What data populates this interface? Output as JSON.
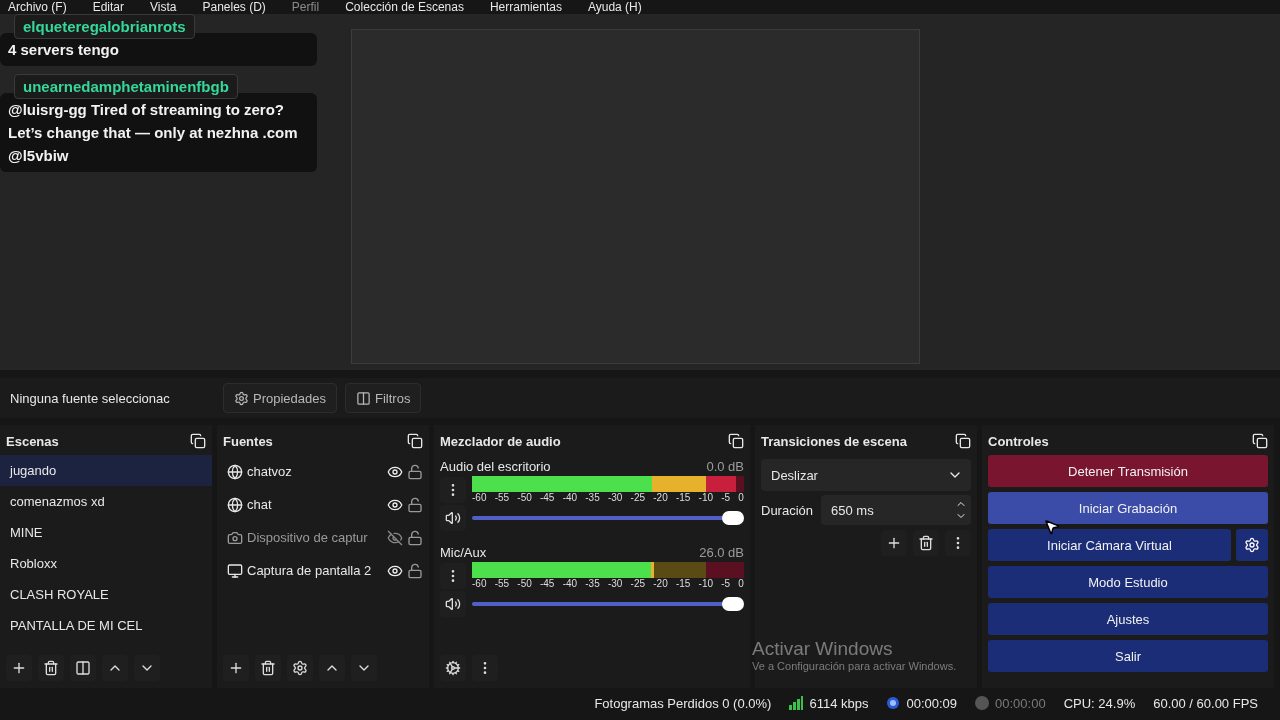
{
  "menu": [
    "Archivo (F)",
    "Editar",
    "Vista",
    "Paneles (D)",
    "Perfil",
    "Colección de Escenas",
    "Herramientas",
    "Ayuda (H)"
  ],
  "preview": {
    "chat_messages": [
      {
        "user": "elqueteregalobrianrots",
        "lines": [
          "4 servers tengo"
        ]
      },
      {
        "user": "unearnedamphetaminenfbgb",
        "lines": [
          "@luisrg-gg Tired of streaming to zero?",
          "Let’s change that — only at nezhna .com",
          "@l5vbiw"
        ]
      }
    ]
  },
  "source_toolbar": {
    "status": "Ninguna fuente seleccionac",
    "buttons": [
      {
        "kind": "properties",
        "label": "Propiedades"
      },
      {
        "kind": "filters",
        "label": "Filtros"
      }
    ]
  },
  "scenes": {
    "title": "Escenas",
    "items": [
      {
        "label": "jugando",
        "selected": true
      },
      {
        "label": "comenazmos xd",
        "selected": false
      },
      {
        "label": "MINE",
        "selected": false
      },
      {
        "label": "Robloxx",
        "selected": false
      },
      {
        "label": "CLASH ROYALE",
        "selected": false
      },
      {
        "label": "PANTALLA DE MI CEL",
        "selected": false
      }
    ]
  },
  "sources": {
    "title": "Fuentes",
    "items": [
      {
        "kind": "browser",
        "label": "chatvoz",
        "visible": true,
        "locked": false
      },
      {
        "kind": "browser",
        "label": "chat",
        "visible": true,
        "locked": false
      },
      {
        "kind": "camera",
        "label": "Dispositivo de captur",
        "visible": false,
        "locked": false
      },
      {
        "kind": "display",
        "label": "Captura de pantalla 2",
        "visible": true,
        "locked": false
      }
    ]
  },
  "mixer": {
    "title": "Mezclador de audio",
    "channels": [
      {
        "name": "Audio del escritorio",
        "reading": "0.0 dB",
        "meter": {
          "level": 0.97
        },
        "volume": {
          "level": 1
        },
        "scale": [
          "-60",
          "-55",
          "-50",
          "-45",
          "-40",
          "-35",
          "-30",
          "-25",
          "-20",
          "-15",
          "-10",
          "-5",
          "0"
        ]
      },
      {
        "name": "Mic/Aux",
        "reading": "26.0 dB",
        "meter": {
          "level": 0.67
        },
        "volume": {
          "level": 1
        },
        "scale": [
          "-60",
          "-55",
          "-50",
          "-45",
          "-40",
          "-35",
          "-30",
          "-25",
          "-20",
          "-15",
          "-10",
          "-5",
          "0"
        ]
      }
    ]
  },
  "transitions": {
    "title": "Transiciones de escena",
    "type": "Deslizar",
    "duration_label": "Duración",
    "duration": "650 ms"
  },
  "controls": {
    "title": "Controles",
    "buttons": [
      {
        "label": "Detener Transmisión",
        "kind": "danger",
        "hovered": false
      },
      {
        "label": "Iniciar Grabación",
        "kind": "normal",
        "hovered": true
      },
      {
        "label": "Iniciar Cámara Virtual",
        "kind": "with_settings",
        "hovered": false
      },
      {
        "label": "Modo Estudio",
        "kind": "normal",
        "hovered": false
      },
      {
        "label": "Ajustes",
        "kind": "normal",
        "hovered": false
      },
      {
        "label": "Salir",
        "kind": "normal",
        "hovered": false
      }
    ]
  },
  "os_notice": {
    "title": "Activar Windows",
    "subtitle": "Ve a Configuración para activar Windows."
  },
  "status_bar": {
    "dropped": "Fotogramas Perdidos 0 (0.0%)",
    "bitrate": "6114 kbps",
    "stream_time": "00:00:09",
    "record_time": "00:00:00",
    "cpu": "CPU: 24.9%",
    "fps": "60.00 / 60.00 FPS"
  }
}
